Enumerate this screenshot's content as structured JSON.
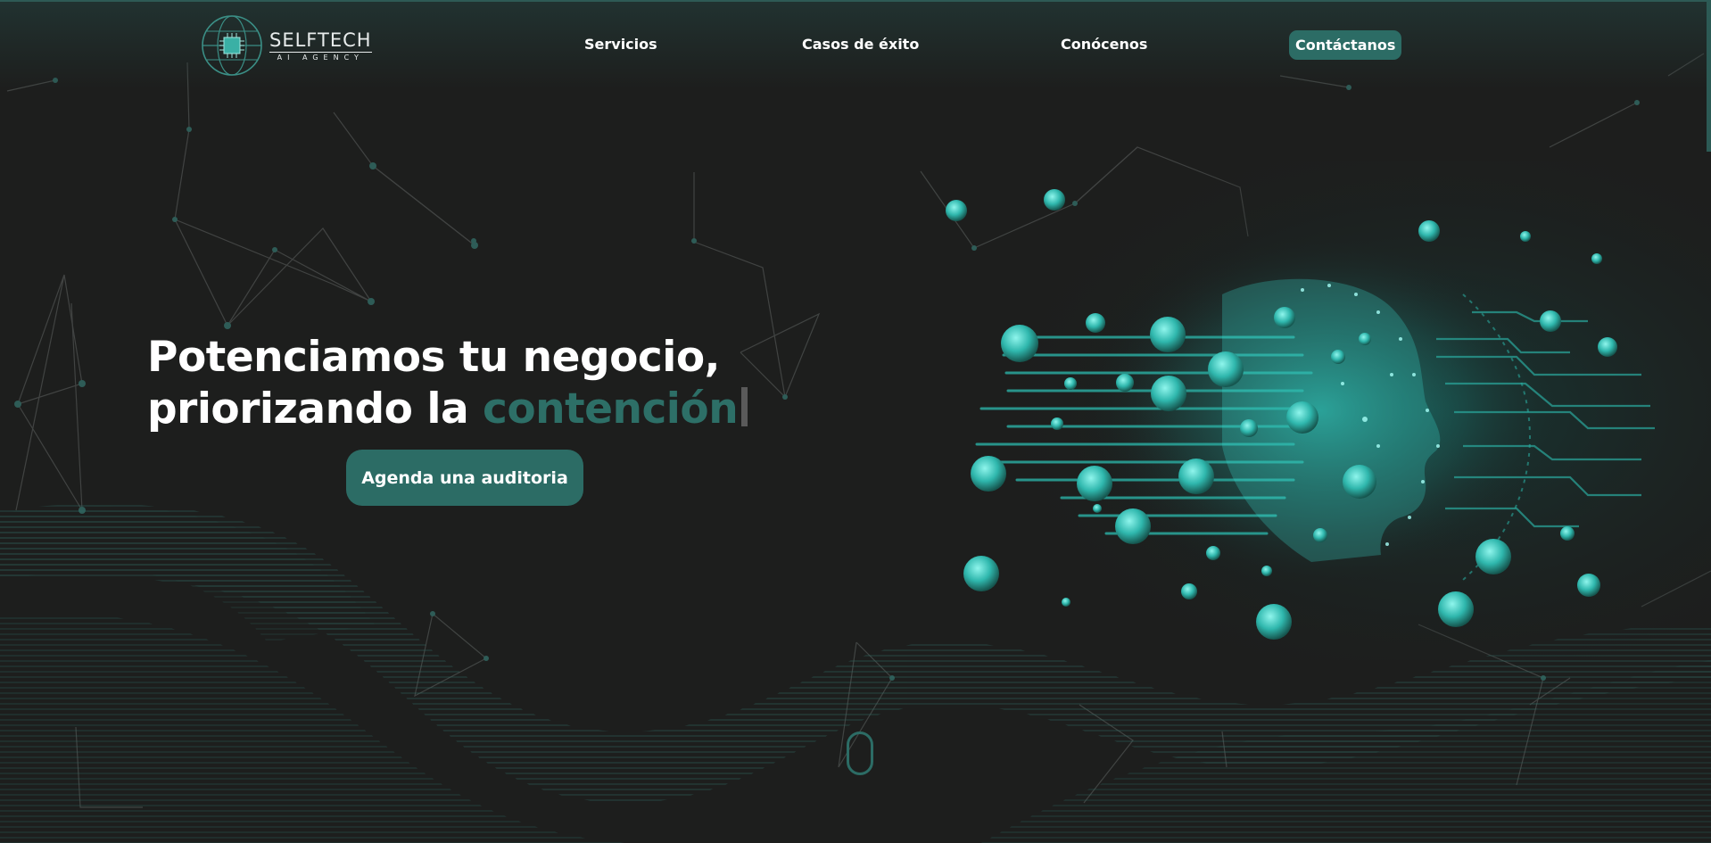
{
  "logo": {
    "word": "SELFTECH",
    "sub": "AI AGENCY"
  },
  "nav": {
    "items": [
      {
        "label": "Servicios"
      },
      {
        "label": "Casos de éxito"
      },
      {
        "label": "Conócenos"
      },
      {
        "label": "Contáctanos"
      }
    ]
  },
  "hero": {
    "line1": "Potenciamos tu negocio,",
    "line2_prefix": "priorizando la ",
    "line2_accent": "contención",
    "cta_label": "Agenda una auditoria"
  },
  "colors": {
    "background": "#1d1e1d",
    "accent": "#2c6c65",
    "accent_text": "#2d6f67",
    "glow": "#3ce3d6"
  },
  "icons": {
    "logo": "globe-chip-icon",
    "scroll": "scroll-mouse-icon"
  }
}
